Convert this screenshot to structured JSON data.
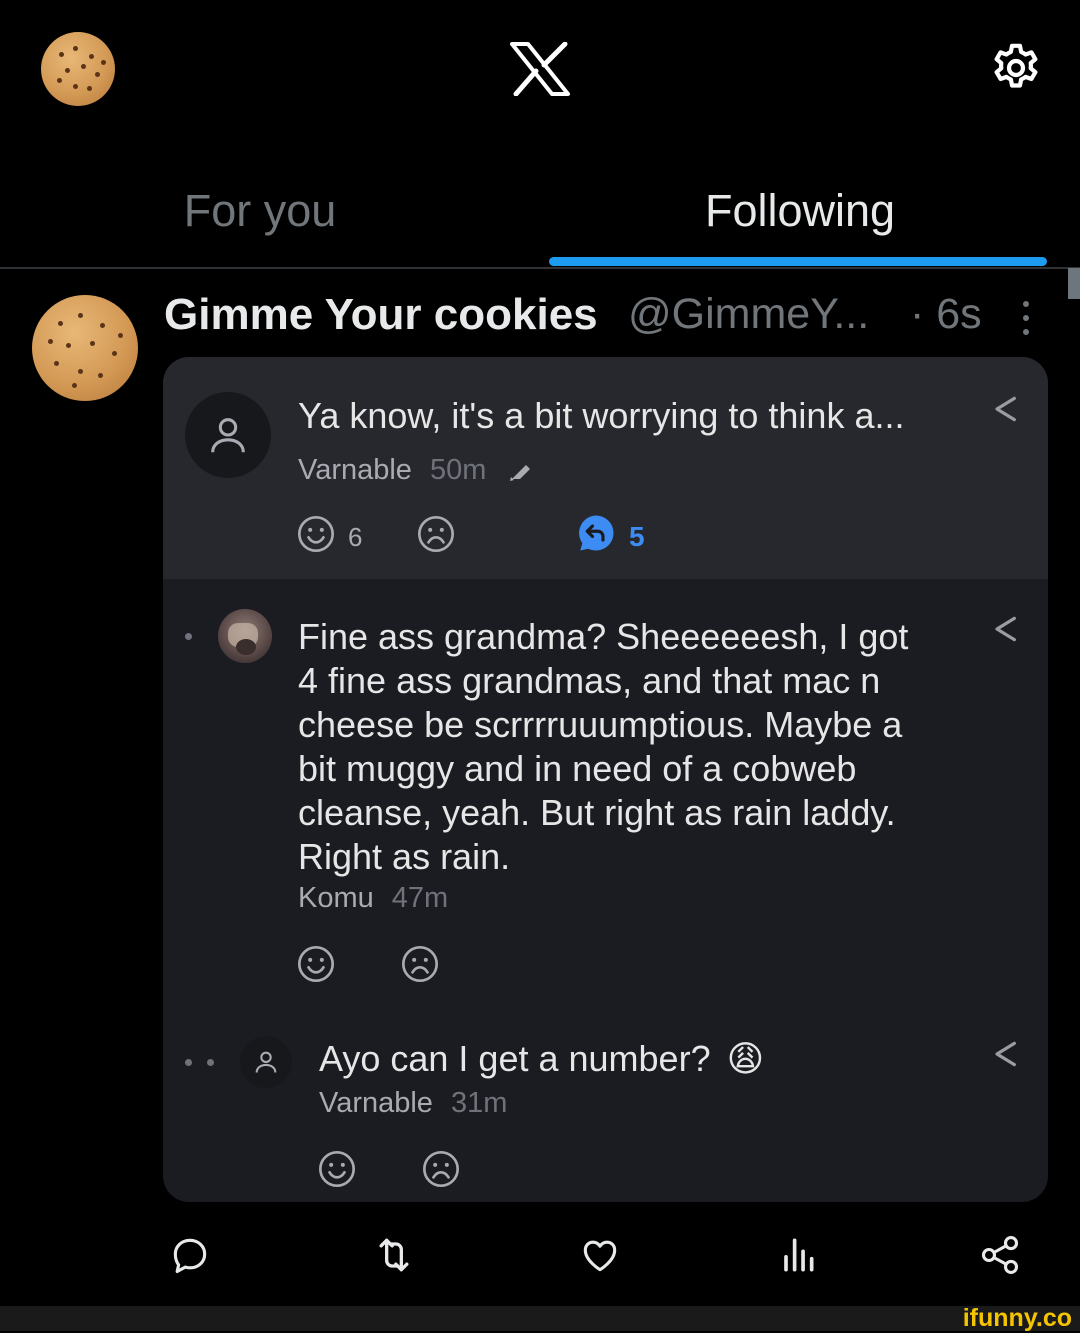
{
  "header": {
    "logo": "X",
    "tabs": [
      {
        "label": "For you",
        "active": false
      },
      {
        "label": "Following",
        "active": true
      }
    ]
  },
  "post": {
    "name": "Gimme Your cookies",
    "handle": "@GimmeY...",
    "time": "· 6s"
  },
  "thread": {
    "root": {
      "text": "Ya know, it's a bit worrying to think a...",
      "author": "Varnable",
      "time": "50m",
      "happy_count": "6",
      "reply_count": "5"
    },
    "reply1": {
      "text": "Fine ass grandma? Sheeeeeesh, I got 4 fine ass grandmas, and that mac n cheese be scrrrruuumptious. Maybe a bit muggy and in need of a cobweb cleanse, yeah. But right as rain laddy. Right as rain.",
      "author": "Komu",
      "time": "47m"
    },
    "reply2": {
      "text": "Ayo can I get a number?",
      "emoji": "😩",
      "author": "Varnable",
      "time": "31m"
    }
  },
  "watermark": "ifunny.co",
  "colors": {
    "accent": "#1d9bf0",
    "background": "#000000",
    "card": "#1b1c22",
    "card_header": "#27282e",
    "reply_blue": "#3d8cf3"
  },
  "icons": [
    "cookie-avatar",
    "x-logo-icon",
    "gear-icon",
    "kebab-icon",
    "user-icon",
    "share-icon",
    "smile-icon",
    "frown-icon",
    "reply-bubble-icon",
    "edit-icon",
    "comment-icon",
    "retweet-icon",
    "heart-icon",
    "views-icon",
    "share-nodes-icon"
  ]
}
